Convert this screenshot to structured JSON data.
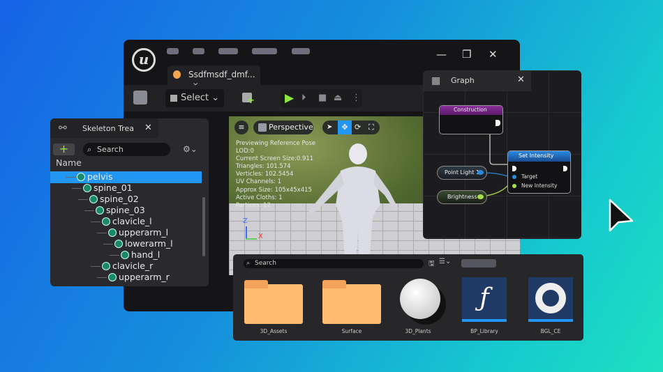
{
  "window": {
    "logo": "u",
    "tab": {
      "title": "Ssdfmsdf_dmf...",
      "close": "×"
    },
    "controls": {
      "minimize": "—",
      "maximize": "❐",
      "close": "✕"
    }
  },
  "toolbar": {
    "select_label": "Select",
    "chevron": "⌄",
    "play": "▶",
    "step": "⏵",
    "stop": "■",
    "eject": "⏏",
    "more": "⋮"
  },
  "viewport": {
    "menu": "≡",
    "view_mode": "Perspective",
    "stats": [
      "Previewing Reference Pose",
      "LOD:0",
      "Current Screen Size:0.911",
      "Triangles: 101.574",
      "Verticles: 102.5454",
      "UV Channels: 1",
      "Approx Size: 105x45x415",
      "Active Cloths: 1",
      "Partices: 12"
    ],
    "axis": {
      "z": "Z",
      "x": "X"
    }
  },
  "skeleton": {
    "title": "Skeleton Trea",
    "close": "✕",
    "add": "+",
    "search_placeholder": "Search",
    "column": "Name",
    "bones": [
      {
        "name": "pelvis",
        "depth": 0,
        "selected": true
      },
      {
        "name": "spine_01",
        "depth": 1
      },
      {
        "name": "spine_02",
        "depth": 2
      },
      {
        "name": "spine_03",
        "depth": 3
      },
      {
        "name": "clavicle_l",
        "depth": 4
      },
      {
        "name": "upperarm_l",
        "depth": 5
      },
      {
        "name": "lowerarm_l",
        "depth": 6
      },
      {
        "name": "hand_l",
        "depth": 7
      },
      {
        "name": "clavicle_r",
        "depth": 4
      },
      {
        "name": "upperarm_r",
        "depth": 5
      }
    ]
  },
  "graph": {
    "title": "Graph",
    "close": "✕",
    "nodes": {
      "construction": "Construction",
      "set_intensity": "Set Intensity",
      "target": "Target",
      "new_intensity": "New Intensity",
      "point_light": "Point Light 1",
      "brightness": "Brightness"
    }
  },
  "content_browser": {
    "search_placeholder": "Search",
    "assets": [
      {
        "name": "3D_Assets",
        "type": "folder"
      },
      {
        "name": "Surface",
        "type": "folder"
      },
      {
        "name": "3D_Plants",
        "type": "sphere"
      },
      {
        "name": "BP_Library",
        "type": "function-library"
      },
      {
        "name": "BGL_CE",
        "type": "ring"
      }
    ]
  },
  "colors": {
    "accent": "#2196f3",
    "play": "#8ee83a",
    "folder": "#ffbb70",
    "construction": "#7a2a8a"
  }
}
